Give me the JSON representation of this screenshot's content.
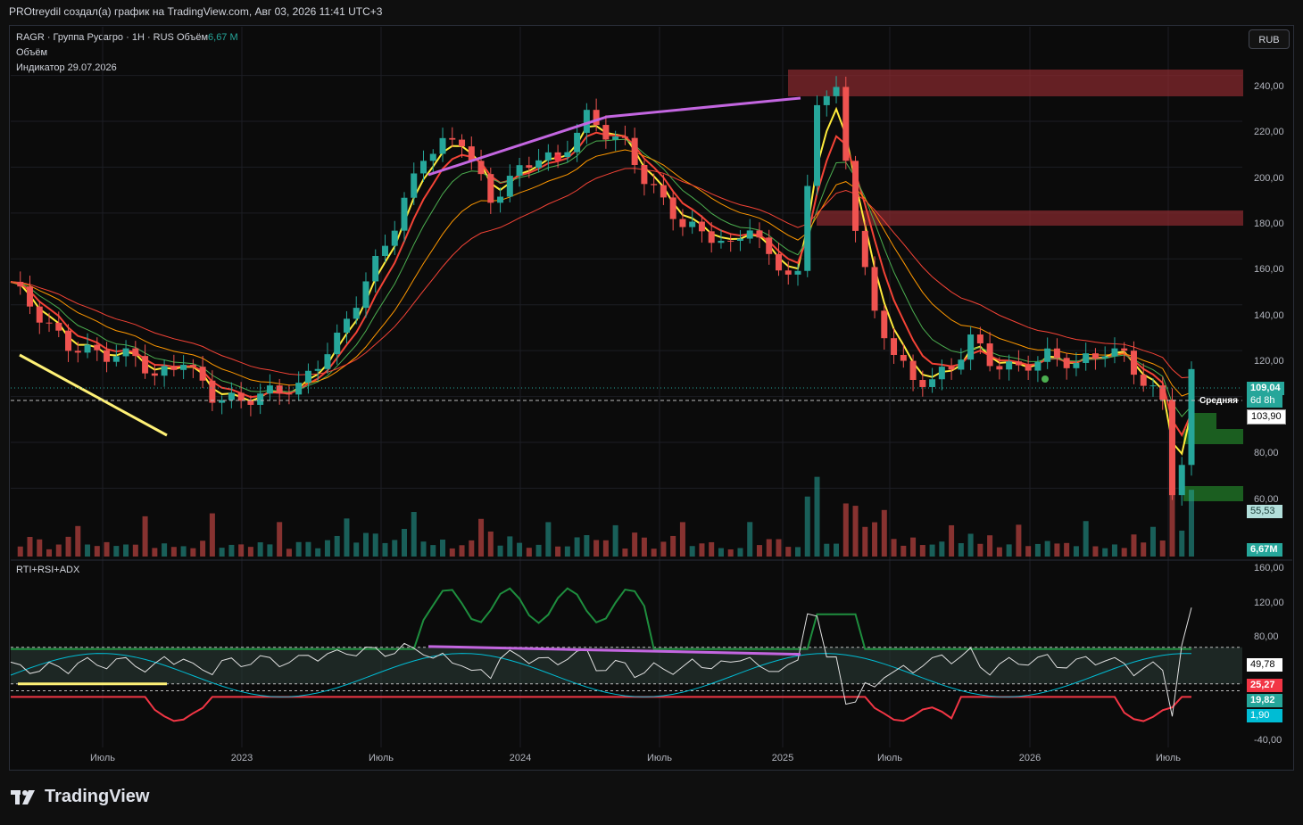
{
  "header": {
    "attribution": "PROtreydil создал(а) график на TradingView.com, Авг 03, 2026 11:41 UTC+3"
  },
  "legend": {
    "symbol_line": "RAGR · Группа Русагро · 1Н · RUS",
    "volume_label": "Объём",
    "volume_value": "6,67 M",
    "line2": "Объём",
    "line3": "Индикатор 29.07.2026",
    "osc_title": "RTI+RSI+ADX"
  },
  "currency_button": "RUB",
  "price_axis": [
    "240,00",
    "220,00",
    "200,00",
    "180,00",
    "160,00",
    "140,00",
    "120,00",
    "80,00",
    "60,00"
  ],
  "osc_axis": [
    "160,00",
    "120,00",
    "80,00",
    "-40,00"
  ],
  "time_axis": [
    "Июль",
    "2023",
    "Июль",
    "2024",
    "Июль",
    "2025",
    "Июль",
    "2026",
    "Июль"
  ],
  "badges": {
    "last_price": "109,04",
    "countdown": "6d 8h",
    "avg_label": "Средняя",
    "avg_value": "103,90",
    "low_value": "55,53",
    "volume": "6,67M",
    "osc1": "49,78",
    "osc2": "25,27",
    "osc3": "19,82",
    "osc4": "1,90"
  },
  "colors": {
    "up": "#26a69a",
    "down": "#ef5350",
    "bull_bright": "#4caf50",
    "bear_bright": "#f7525f",
    "ema_fast": "#ffeb3b",
    "ema_mid": "#4caf50",
    "ema_slow": "#ff9800",
    "ema_long": "#f44336",
    "trend_purple": "#c366e0",
    "zone_red": "#8b2a2f",
    "zone_green": "#1b5e20"
  },
  "brand": "TradingView",
  "chart_data": {
    "type": "candlestick",
    "symbol": "RAGR",
    "interval": "1Н",
    "ylim": [
      45,
      255
    ],
    "close_approx": [
      [
        0,
        150
      ],
      [
        3,
        135
      ],
      [
        6,
        122
      ],
      [
        10,
        118
      ],
      [
        13,
        118
      ],
      [
        15,
        108
      ],
      [
        18,
        116
      ],
      [
        21,
        100
      ],
      [
        24,
        98
      ],
      [
        27,
        102
      ],
      [
        30,
        104
      ],
      [
        34,
        125
      ],
      [
        37,
        150
      ],
      [
        40,
        175
      ],
      [
        43,
        205
      ],
      [
        45,
        210
      ],
      [
        47,
        212
      ],
      [
        50,
        185
      ],
      [
        52,
        195
      ],
      [
        55,
        205
      ],
      [
        57,
        203
      ],
      [
        60,
        222
      ],
      [
        62,
        215
      ],
      [
        64,
        210
      ],
      [
        66,
        195
      ],
      [
        70,
        175
      ],
      [
        73,
        170
      ],
      [
        75,
        165
      ],
      [
        77,
        175
      ],
      [
        79,
        160
      ],
      [
        82,
        152
      ],
      [
        84,
        230
      ],
      [
        86,
        232
      ],
      [
        88,
        175
      ],
      [
        90,
        135
      ],
      [
        92,
        120
      ],
      [
        94,
        106
      ],
      [
        96,
        108
      ],
      [
        98,
        112
      ],
      [
        100,
        126
      ],
      [
        102,
        115
      ],
      [
        105,
        112
      ],
      [
        108,
        118
      ],
      [
        111,
        114
      ],
      [
        114,
        120
      ],
      [
        116,
        118
      ],
      [
        118,
        106
      ],
      [
        120,
        98
      ],
      [
        121,
        60
      ],
      [
        122,
        70
      ],
      [
        123,
        109
      ]
    ],
    "last_price": 109.04,
    "average": 103.9,
    "low": 55.53,
    "volume": "6,67M"
  }
}
